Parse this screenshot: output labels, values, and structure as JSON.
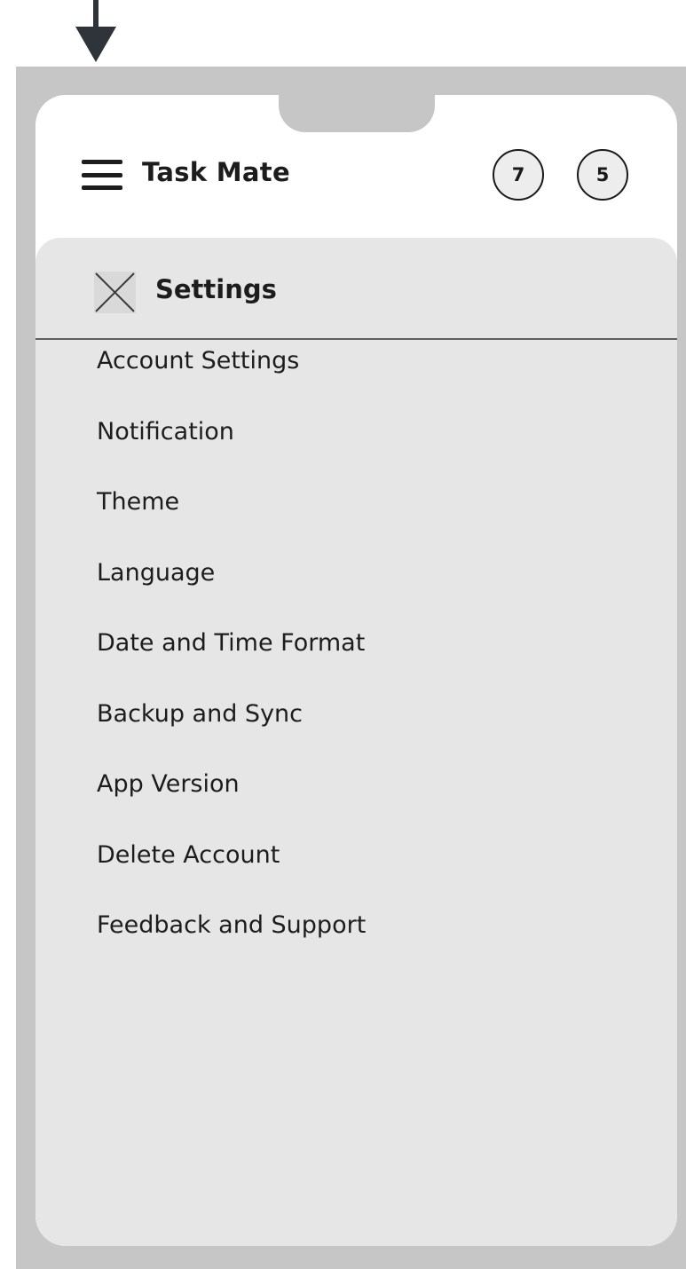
{
  "header": {
    "app_title": "Task Mate",
    "badges": [
      "7",
      "5"
    ]
  },
  "panel": {
    "title": "Settings",
    "items": [
      "Account Settings",
      "Notification",
      "Theme",
      "Language",
      "Date and Time Format",
      "Backup and Sync",
      "App Version",
      "Delete Account",
      "Feedback and Support"
    ]
  },
  "icons": {
    "arrow": "arrow-down-icon",
    "menu": "hamburger-menu-icon",
    "close": "close-icon"
  },
  "colors": {
    "frame": "#c6c6c6",
    "panel_background": "#e6e6e6",
    "text": "#1c1c1c"
  }
}
